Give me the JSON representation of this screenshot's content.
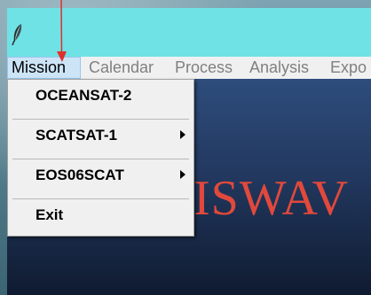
{
  "menubar": {
    "items": [
      {
        "label": "Mission",
        "active": true
      },
      {
        "label": "Calendar"
      },
      {
        "label": "Process"
      },
      {
        "label": "Analysis"
      },
      {
        "label": "Expo"
      }
    ]
  },
  "mission_menu": {
    "items": [
      {
        "label": "OCEANSAT-2",
        "submenu": false
      },
      {
        "label": "SCATSAT-1",
        "submenu": true
      },
      {
        "label": "EOS06SCAT",
        "submenu": true
      },
      {
        "label": "Exit",
        "submenu": false
      }
    ]
  },
  "content": {
    "brand_text": "ISWAV"
  },
  "icons": {
    "app_icon": "feather-icon",
    "submenu_arrow": "chevron-right-icon",
    "annotation": "red-arrow-icon"
  },
  "colors": {
    "titlebar": "#6fe2e6",
    "brand": "#e0493c",
    "annotation": "#e0302a",
    "menu_highlight": "#cde4f7"
  }
}
